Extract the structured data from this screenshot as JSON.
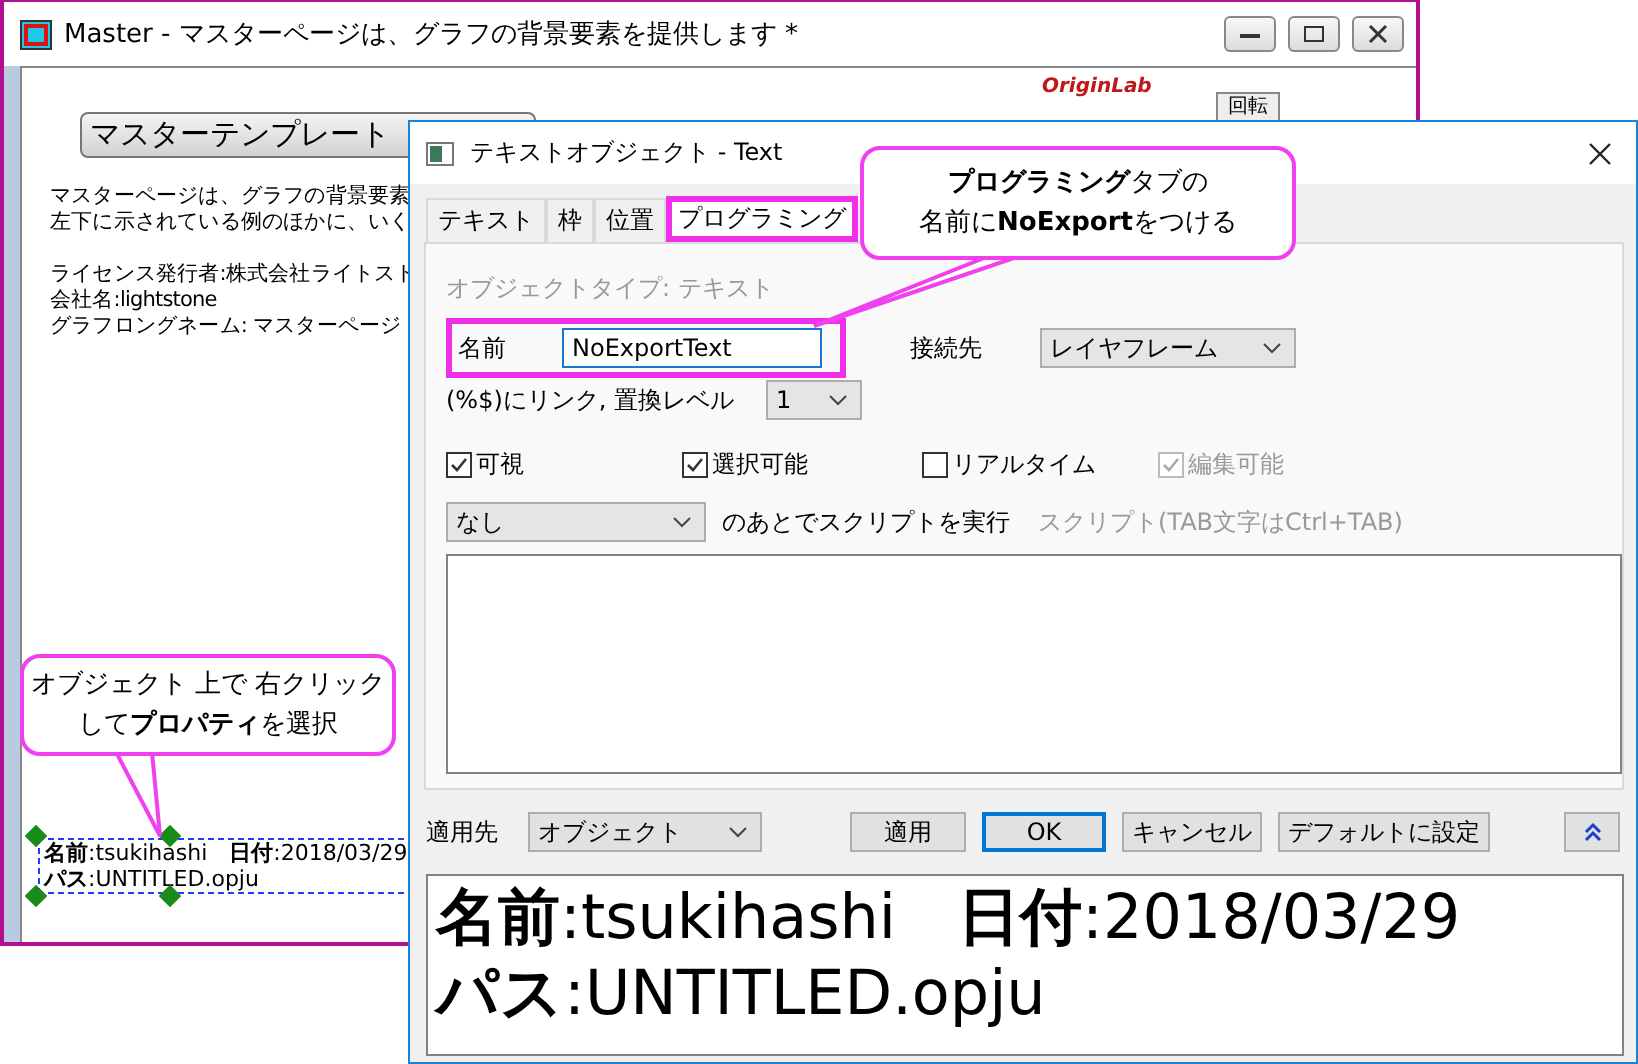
{
  "back_window": {
    "title": "Master - マスターページは、グラフの背景要素を提供します *",
    "logo": "OriginLab",
    "rotate_button": "回転",
    "template_button": "マスターテンプレート",
    "paragraphs": [
      [
        "マスターページは、グラフの背景要素",
        "左下に示されている例のほかに、いく"
      ],
      [
        "ライセンス発行者:株式会社ライトスト",
        "会社名:lightstone",
        "グラフロングネーム: マスターページ"
      ]
    ],
    "text_object": [
      "**名前**:tsukihashi　**日付**:2018/03/29",
      "**パス**:UNTITLED.opju"
    ]
  },
  "dialog": {
    "title": "テキストオブジェクト - Text",
    "tabs": [
      {
        "label": "テキスト",
        "selected": false
      },
      {
        "label": "枠",
        "selected": false
      },
      {
        "label": "位置",
        "selected": false
      },
      {
        "label": "プログラミング",
        "selected": true
      }
    ],
    "object_type": "オブジェクトタイプ: テキスト",
    "name_label": "名前",
    "name_value": "NoExportText",
    "connect_label": "接続先",
    "connect_value": "レイヤフレーム",
    "link_label": "(%$)にリンク, 置換レベル",
    "link_value": "1",
    "checkboxes": [
      {
        "label": "可視",
        "checked": true,
        "disabled": false
      },
      {
        "label": "選択可能",
        "checked": true,
        "disabled": false
      },
      {
        "label": "リアルタイム",
        "checked": false,
        "disabled": false
      },
      {
        "label": "編集可能",
        "checked": true,
        "disabled": true
      }
    ],
    "script_trigger": "なし",
    "script_after": "のあとでスクリプトを実行",
    "script_hint": "スクリプト(TAB文字はCtrl+TAB)",
    "apply_to_label": "適用先",
    "apply_to_value": "オブジェクト",
    "buttons": [
      {
        "label": "適用",
        "default": false
      },
      {
        "label": "OK",
        "default": true
      },
      {
        "label": "キャンセル",
        "default": false
      },
      {
        "label": "デフォルトに設定",
        "default": false
      }
    ],
    "preview": [
      "**名前**:tsukihashi　**日付**:2018/03/29",
      "**パス**:UNTITLED.opju"
    ]
  },
  "callouts": [
    {
      "lines": [
        "**プログラミング**タブの",
        "名前に**NoExport**をつける"
      ]
    },
    {
      "lines": [
        "オブジェクト 上で 右クリック",
        "して**プロパティ**を選択"
      ]
    }
  ]
}
